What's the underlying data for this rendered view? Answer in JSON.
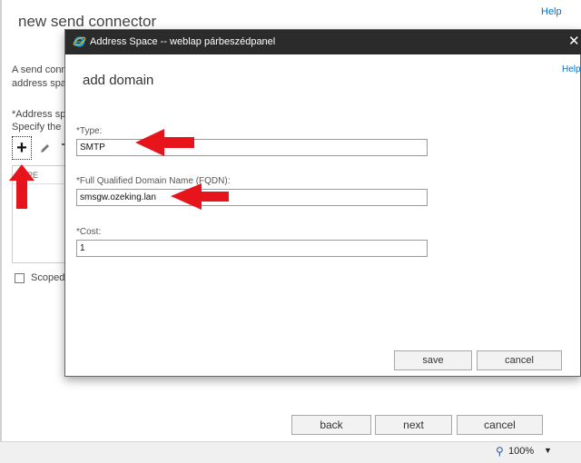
{
  "background_wizard": {
    "title": "new send connector",
    "help": "Help",
    "text_line1": "A send conn",
    "text_line2": "address spac",
    "address_space_label": "*Address spa",
    "specify_text": "Specify the a",
    "list_header": "PE",
    "scoped_label": "Scoped",
    "buttons": {
      "back": "back",
      "next": "next",
      "cancel": "cancel"
    },
    "zoom": "100%"
  },
  "dialog": {
    "title": "Address Space -- weblap párbeszédpanel",
    "heading": "add domain",
    "help": "Help",
    "fields": {
      "type": {
        "label": "*Type:",
        "value": "SMTP"
      },
      "fqdn": {
        "label": "*Full Qualified Domain Name (FQDN):",
        "value": "smsgw.ozeking.lan"
      },
      "cost": {
        "label": "*Cost:",
        "value": "1"
      }
    },
    "buttons": {
      "save": "save",
      "cancel": "cancel"
    }
  },
  "colors": {
    "annotation_arrow": "#e8141b",
    "link": "#0072c6",
    "titlebar": "#2b2b2b"
  }
}
